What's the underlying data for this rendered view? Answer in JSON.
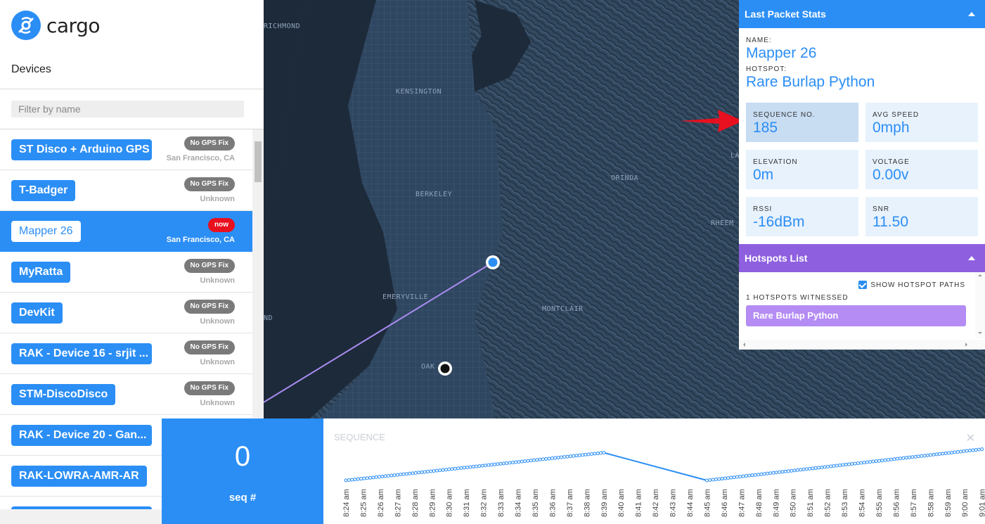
{
  "app": {
    "logo_text": "cargo"
  },
  "sidebar": {
    "title": "Devices",
    "filter_placeholder": "Filter by name",
    "devices": [
      {
        "name": "ST Disco + Arduino GPS",
        "badge": "No GPS Fix",
        "location": "San Francisco, CA",
        "selected": false
      },
      {
        "name": "T-Badger",
        "badge": "No GPS Fix",
        "location": "Unknown",
        "selected": false
      },
      {
        "name": "Mapper 26",
        "badge": "now",
        "location": "San Francisco, CA",
        "selected": true
      },
      {
        "name": "MyRatta",
        "badge": "No GPS Fix",
        "location": "Unknown",
        "selected": false
      },
      {
        "name": "DevKit",
        "badge": "No GPS Fix",
        "location": "Unknown",
        "selected": false
      },
      {
        "name": "RAK - Device 16 - srjit ...",
        "badge": "No GPS Fix",
        "location": "Unknown",
        "selected": false
      },
      {
        "name": "STM-DiscoDisco",
        "badge": "No GPS Fix",
        "location": "Unknown",
        "selected": false
      },
      {
        "name": "RAK - Device 20 - Gan...",
        "badge": "",
        "location": "",
        "selected": false
      },
      {
        "name": "RAK-LOWRA-AMR-AR",
        "badge": "",
        "location": "",
        "selected": false
      }
    ]
  },
  "map": {
    "labels": [
      "RICHMOND",
      "KENSINGTON",
      "BERKELEY",
      "EMERYVILLE",
      "OAK",
      "ND",
      "ORINDA",
      "MONTCLAIR",
      "RHEEM",
      "LA"
    ],
    "path_color": "#a98bf0",
    "device_marker_color": "#2b8ef5",
    "hotspot_marker_color": "#111111"
  },
  "stats": {
    "header": "Last Packet Stats",
    "name_label": "NAME:",
    "name_value": "Mapper 26",
    "hotspot_label": "HOTSPOT:",
    "hotspot_value": "Rare Burlap Python",
    "tiles": [
      {
        "label": "SEQUENCE NO.",
        "value": "185"
      },
      {
        "label": "AVG SPEED",
        "value": "0mph"
      },
      {
        "label": "ELEVATION",
        "value": "0m"
      },
      {
        "label": "VOLTAGE",
        "value": "0.00v"
      },
      {
        "label": "RSSI",
        "value": "-16dBm"
      },
      {
        "label": "SNR",
        "value": "11.50"
      }
    ]
  },
  "hotspots": {
    "header": "Hotspots List",
    "show_paths_label": "SHOW HOTSPOT PATHS",
    "show_paths_checked": true,
    "witnessed_label": "1 HOTSPOTS WITNESSED",
    "items": [
      "Rare Burlap Python"
    ]
  },
  "sequence_box": {
    "value": "0",
    "label": "seq #"
  },
  "chart_data": {
    "type": "line",
    "title": "SEQUENCE",
    "x": [
      "8:24 am",
      "8:25 am",
      "8:26 am",
      "8:27 am",
      "8:28 am",
      "8:29 am",
      "8:30 am",
      "8:31 am",
      "8:32 am",
      "8:33 am",
      "8:34 am",
      "8:35 am",
      "8:36 am",
      "8:37 am",
      "8:38 am",
      "8:39 am",
      "8:40 am",
      "8:41 am",
      "8:42 am",
      "8:43 am",
      "8:44 am",
      "8:45 am",
      "8:46 am",
      "8:47 am",
      "8:48 am",
      "8:49 am",
      "8:50 am",
      "8:51 am",
      "8:52 am",
      "8:53 am",
      "8:54 am",
      "8:55 am",
      "8:56 am",
      "8:57 am",
      "8:58 am",
      "8:59 am",
      "9:00 am",
      "9:01 am"
    ],
    "series": [
      {
        "segments": [
          {
            "start": "8:24 am",
            "end": "8:39 am",
            "y_start": 0,
            "y_end": 164
          },
          {
            "start": "8:45 am",
            "end": "9:01 am",
            "y_start": 0,
            "y_end": 185
          }
        ]
      }
    ],
    "ylim": [
      0,
      200
    ],
    "color": "#2b8ef5"
  }
}
